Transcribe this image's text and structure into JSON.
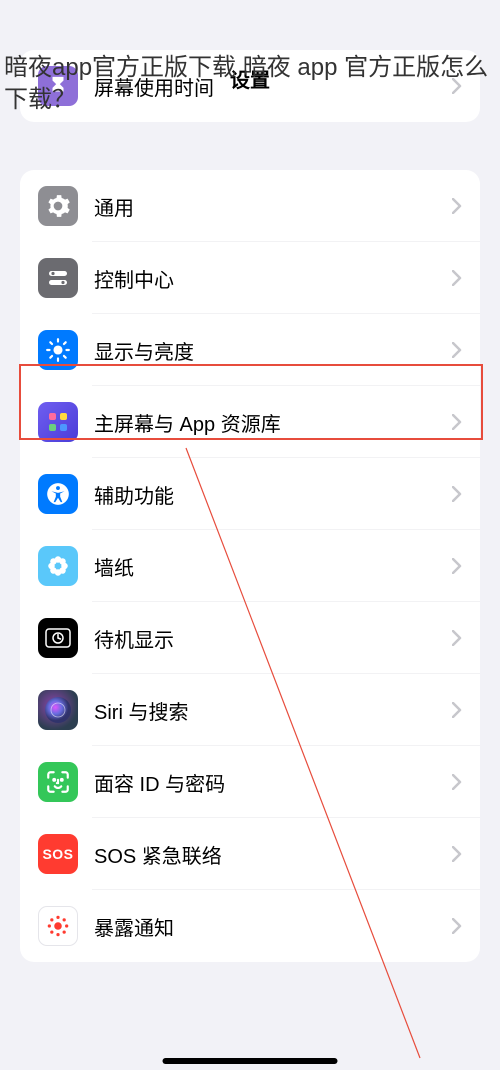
{
  "overlay_text": "暗夜app官方正版下载 暗夜 app 官方正版怎么下载？",
  "header_title": "设置",
  "screen_time_label": "屏幕使用时间",
  "items": [
    {
      "label": "通用",
      "icon": "gear-icon",
      "bg": "bg-grey"
    },
    {
      "label": "控制中心",
      "icon": "switches-icon",
      "bg": "bg-darkgrey"
    },
    {
      "label": "显示与亮度",
      "icon": "brightness-icon",
      "bg": "bg-blue",
      "highlighted": true
    },
    {
      "label": "主屏幕与 App 资源库",
      "icon": "apps-grid-icon",
      "bg": "bg-purple-grad"
    },
    {
      "label": "辅助功能",
      "icon": "accessibility-icon",
      "bg": "bg-blue"
    },
    {
      "label": "墙纸",
      "icon": "flower-icon",
      "bg": "bg-teal"
    },
    {
      "label": "待机显示",
      "icon": "clock-icon",
      "bg": "bg-black"
    },
    {
      "label": "Siri 与搜索",
      "icon": "siri-icon",
      "bg": "bg-siri"
    },
    {
      "label": "面容 ID 与密码",
      "icon": "faceid-icon",
      "bg": "bg-green"
    },
    {
      "label": "SOS 紧急联络",
      "icon": "sos-icon",
      "bg": "bg-red"
    },
    {
      "label": "暴露通知",
      "icon": "exposure-icon",
      "bg": "bg-white-bordered"
    }
  ]
}
